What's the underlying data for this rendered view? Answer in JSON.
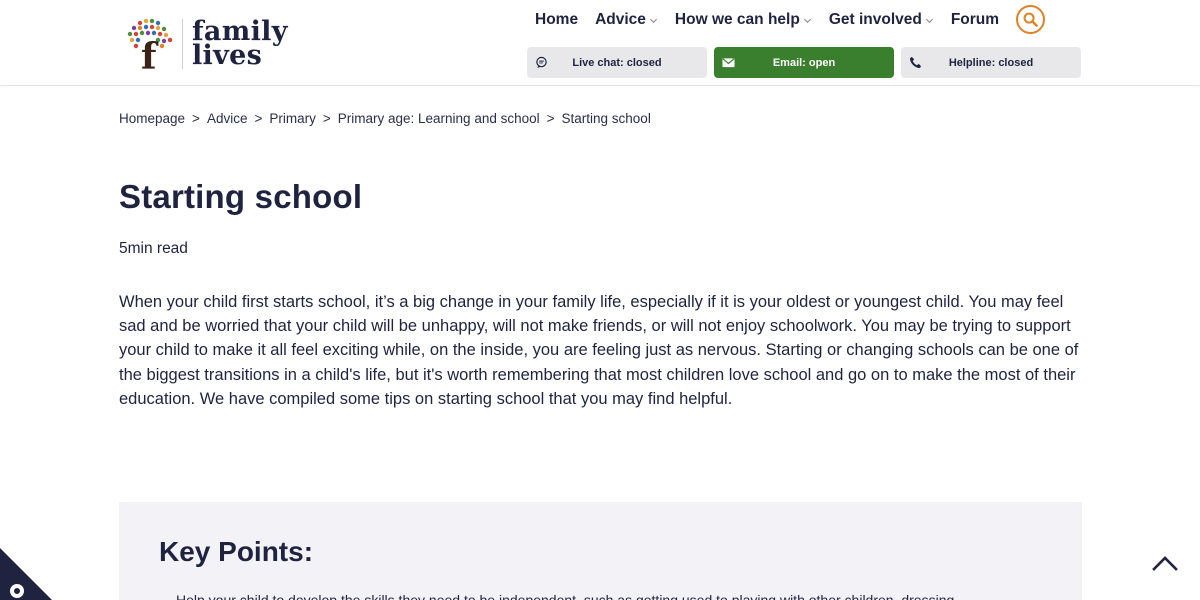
{
  "brand": {
    "name_line1": "family",
    "name_line2": "lives"
  },
  "nav": {
    "items": [
      {
        "label": "Home",
        "has_dropdown": false
      },
      {
        "label": "Advice",
        "has_dropdown": true
      },
      {
        "label": "How we can help",
        "has_dropdown": true
      },
      {
        "label": "Get involved",
        "has_dropdown": true
      },
      {
        "label": "Forum",
        "has_dropdown": false
      }
    ],
    "search_icon": "search-icon"
  },
  "contact": {
    "live_chat": {
      "label": "Live chat: closed",
      "icon": "chat-bubble-icon"
    },
    "email": {
      "label": "Email: open",
      "icon": "envelope-icon"
    },
    "helpline": {
      "label": "Helpline: closed",
      "icon": "phone-icon"
    }
  },
  "breadcrumb": {
    "separator": ">",
    "items": [
      "Homepage",
      "Advice",
      "Primary",
      "Primary age: Learning and school",
      "Starting school"
    ]
  },
  "article": {
    "title": "Starting school",
    "read_time": "5min read",
    "intro": "When your child first starts school, it’s a big change in your family life, especially if it is your oldest or youngest child. You may feel sad and be worried that your child will be unhappy, will not make friends, or will not enjoy schoolwork. You may be trying to support your child to make it all feel exciting while, on the inside, you are feeling just as nervous. Starting or changing schools can be one of the biggest transitions in a child's life, but it's worth remembering that most children love school and go on to make the most of their education. We have compiled some tips on starting school that you may find helpful."
  },
  "key_points": {
    "title": "Key Points:",
    "first_item": "Help your child to develop the skills they need to be independent, such as getting used to playing with other children, dressing"
  },
  "colors": {
    "navy": "#1f2340",
    "accent_orange": "#e0822a",
    "email_green": "#3a7f2d",
    "pill_grey": "#e8e8ea",
    "key_box_bg": "#f3f3f7"
  }
}
